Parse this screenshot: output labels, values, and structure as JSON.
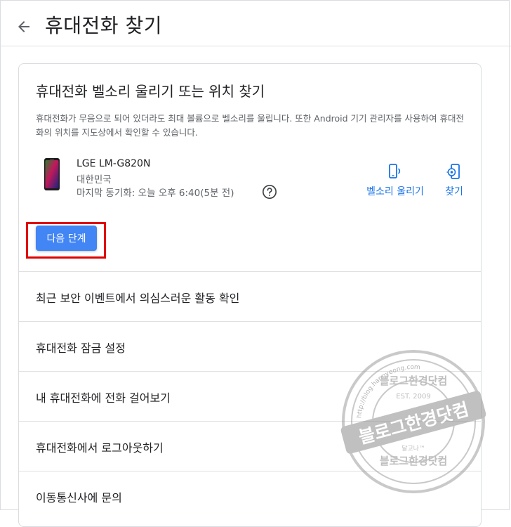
{
  "header": {
    "title": "휴대전화 찾기"
  },
  "card": {
    "title": "휴대전화 벨소리 울리기 또는 위치 찾기",
    "description": "휴대전화가 무음으로 되어 있더라도 최대 볼륨으로 벨소리를 울립니다. 또한 Android 기기 관리자를 사용하여 휴대전화의 위치를 지도상에서 확인할 수 있습니다.",
    "device": {
      "name": "LGE LM-G820N",
      "country": "대한민국",
      "last_sync": "마지막 동기화: 오늘 오후 6:40(5분 전)"
    },
    "actions": {
      "ring_label": "벨소리 울리기",
      "find_label": "찾기"
    },
    "next_button": "다음 단계"
  },
  "menu": [
    {
      "label": "최근 보안 이벤트에서 의심스러운 활동 확인"
    },
    {
      "label": "휴대전화 잠금 설정"
    },
    {
      "label": "내 휴대전화에 전화 걸어보기"
    },
    {
      "label": "휴대전화에서 로그아웃하기"
    },
    {
      "label": "이동통신사에 문의"
    }
  ],
  "watermark": {
    "text_main": "블로그한경닷컴",
    "text_top": "블로그한경닷컴",
    "text_est": "EST. 2009",
    "text_url": "http://blog.hangyeong.com",
    "text_small": "달고나™"
  },
  "colors": {
    "accent": "#1a73e8",
    "button": "#4285f4",
    "highlight": "#e00000"
  }
}
